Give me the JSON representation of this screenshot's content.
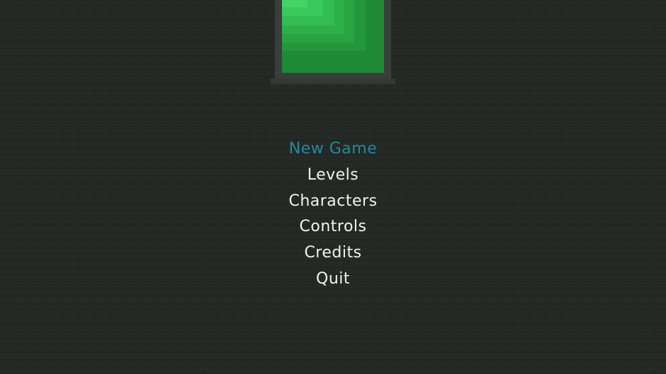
{
  "menu": {
    "items": [
      {
        "label": "New Game",
        "selected": true
      },
      {
        "label": "Levels",
        "selected": false
      },
      {
        "label": "Characters",
        "selected": false
      },
      {
        "label": "Controls",
        "selected": false
      },
      {
        "label": "Credits",
        "selected": false
      },
      {
        "label": "Quit",
        "selected": false
      }
    ]
  },
  "colors": {
    "background": "#262a27",
    "selected_text": "#1f8a9a",
    "text": "#f2f2f2",
    "emblem_green": "#1f8a35"
  }
}
